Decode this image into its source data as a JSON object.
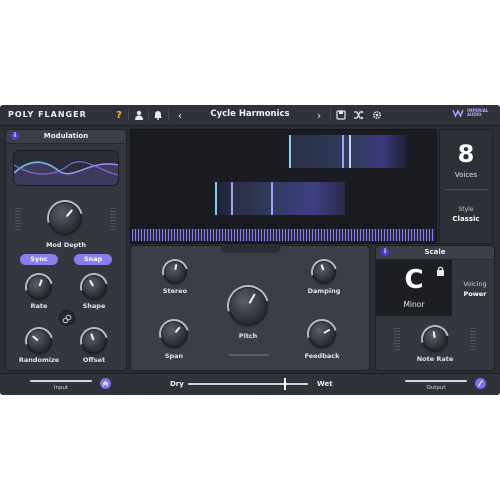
{
  "app": {
    "title": "POLY FLANGER"
  },
  "topbar": {
    "help_icon": "?",
    "preset_name": "Cycle Harmonics",
    "prev_arrow": "‹",
    "next_arrow": "›",
    "logo_line1": "IMPERIAL",
    "logo_line2": "AUDIO"
  },
  "modulation": {
    "title": "Modulation",
    "info": "i",
    "mod_depth_label": "Mod Depth",
    "sync_label": "Sync",
    "snap_label": "Snap",
    "rate_label": "Rate",
    "shape_label": "Shape",
    "randomize_label": "Randomize",
    "offset_label": "Offset"
  },
  "voices": {
    "count": "8",
    "label": "Voices",
    "style_label": "Style",
    "style_value": "Classic"
  },
  "center": {
    "stereo_label": "Stereo",
    "damping_label": "Damping",
    "pitch_label": "Pitch",
    "span_label": "Span",
    "feedback_label": "Feedback"
  },
  "scale": {
    "title": "Scale",
    "info": "i",
    "key": "C",
    "mode": "Minor",
    "voicing_label": "Voicing",
    "voicing_value": "Power",
    "note_rate_label": "Note Rate"
  },
  "bottom": {
    "input_label": "Input",
    "output_label": "Output",
    "dry_label": "Dry",
    "wet_label": "Wet",
    "dry_wet_value": 0.8
  },
  "colors": {
    "accent": "#8b7cf0",
    "background": "#2a2d34"
  }
}
